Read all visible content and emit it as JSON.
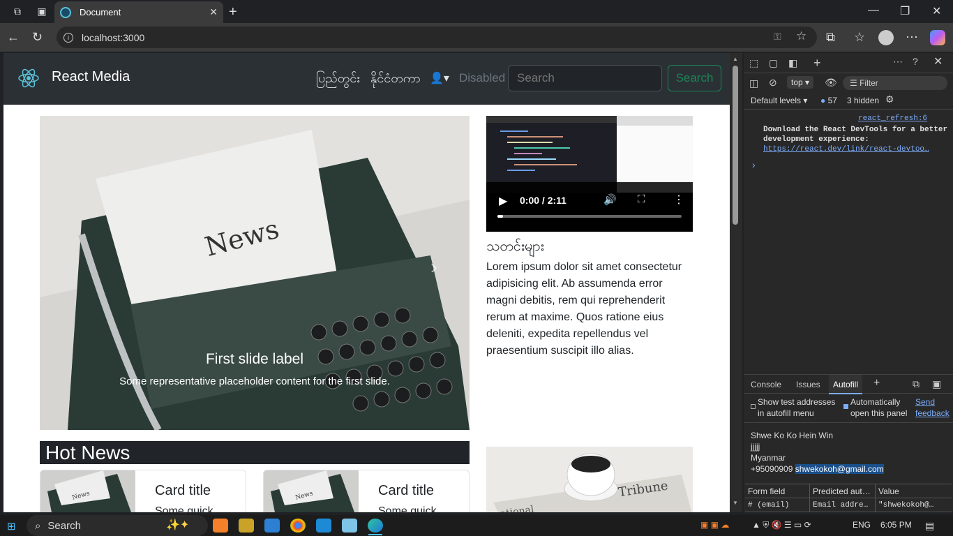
{
  "browser": {
    "tab_title": "Document",
    "url": "localhost:3000"
  },
  "app": {
    "brand": "React Media",
    "nav_links": [
      "ပြည်တွင်း",
      "နိုင်ငံတကာ"
    ],
    "disabled_link": "Disabled",
    "search_placeholder": "Search",
    "search_button": "Search"
  },
  "carousel": {
    "caption_title": "First slide label",
    "caption_text": "Some representative placeholder content for the first slide."
  },
  "video": {
    "time": "0:00 / 2:11"
  },
  "news": {
    "heading": "သတင်းများ",
    "body": "Lorem ipsum dolor sit amet consectetur adipisicing elit. Ab assumenda error magni debitis, rem qui reprehenderit rerum at maxime. Quos ratione eius deleniti, expedita repellendus vel praesentium suscipit illo alias."
  },
  "hot_news": {
    "heading": "Hot News",
    "cards": [
      {
        "title": "Card title",
        "text": "Some quick"
      },
      {
        "title": "Card title",
        "text": "Some quick"
      }
    ]
  },
  "devtools": {
    "context": "top",
    "filter": "Filter",
    "levels": "Default levels",
    "issue_count": "57",
    "hidden": "3 hidden",
    "source_link": "react_refresh:6",
    "message": "Download the React DevTools for a better development experience:",
    "message_link": "https://react.dev/link/react-devtoo…",
    "tabs": [
      "Console",
      "Issues",
      "Autofill"
    ],
    "autofill": {
      "option1": "Show test addresses in autofill menu",
      "option2": "Automatically open this panel",
      "feedback": "Send feedback",
      "name": "Shwe Ko Ko Hein Win",
      "line2": "jjjjj",
      "country": "Myanmar",
      "phone": "+95090909",
      "email": "shwekokoh@gmail.com",
      "table_headers": [
        "Form field",
        "Predicted aut…",
        "Value"
      ],
      "table_row": [
        "# (email)",
        "Email addre…",
        "\"shwekokoh@…"
      ]
    }
  },
  "taskbar": {
    "search": "Search",
    "lang": "ENG",
    "time": "6:05 PM"
  }
}
